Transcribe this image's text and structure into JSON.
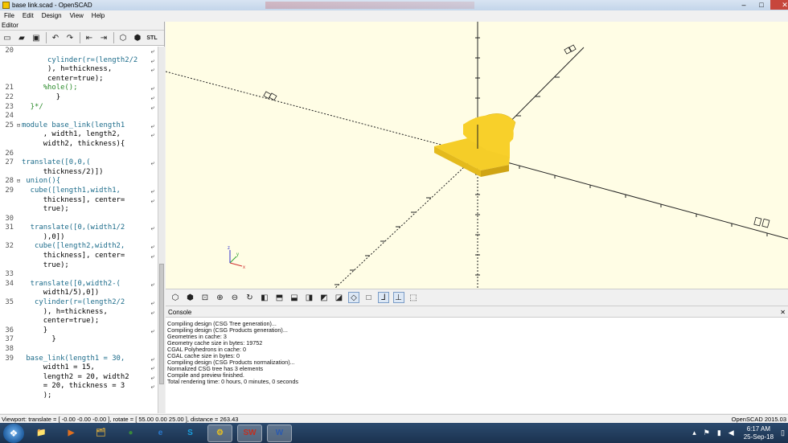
{
  "window": {
    "title": "base link.scad - OpenSCAD",
    "controls": {
      "minimize": "–",
      "maximize": "□",
      "close": "✕"
    }
  },
  "menu": [
    "File",
    "Edit",
    "Design",
    "View",
    "Help"
  ],
  "editor": {
    "label": "Editor",
    "toolbar": [
      "new-file-icon",
      "open-file-icon",
      "save-file-icon",
      "undo-icon",
      "redo-icon",
      "unindent-icon",
      "indent-icon",
      "preview-icon",
      "render-icon",
      "export-stl-icon"
    ],
    "lines": [
      {
        "n": "20",
        "t": "",
        "wrap": true
      },
      {
        "n": "",
        "t": "      cylinder(r=(length2/2",
        "wrap": true
      },
      {
        "n": "",
        "t": "      ), h=thickness,",
        "wrap": true
      },
      {
        "n": "",
        "t": "      center=true);",
        "wrap": false
      },
      {
        "n": "21",
        "t": "     %hole();",
        "wrap": true
      },
      {
        "n": "22",
        "t": "        }",
        "wrap": true
      },
      {
        "n": "23",
        "t": "  }*/",
        "wrap": true
      },
      {
        "n": "24",
        "t": "",
        "wrap": false
      },
      {
        "n": "25",
        "t": "module base_link(length1",
        "wrap": true,
        "fold": true
      },
      {
        "n": "",
        "t": "     , width1, length2,",
        "wrap": true
      },
      {
        "n": "",
        "t": "     width2, thickness){",
        "wrap": false
      },
      {
        "n": "26",
        "t": "",
        "wrap": false
      },
      {
        "n": "27",
        "t": "translate([0,0,(",
        "wrap": true
      },
      {
        "n": "",
        "t": "     thickness/2)])",
        "wrap": false
      },
      {
        "n": "28",
        "t": " union(){",
        "wrap": false,
        "fold": true
      },
      {
        "n": "29",
        "t": "  cube([length1,width1,",
        "wrap": true
      },
      {
        "n": "",
        "t": "     thickness], center=",
        "wrap": true
      },
      {
        "n": "",
        "t": "     true);",
        "wrap": false
      },
      {
        "n": "30",
        "t": "",
        "wrap": false
      },
      {
        "n": "31",
        "t": "  translate([0,(width1/2",
        "wrap": true
      },
      {
        "n": "",
        "t": "     ),0])",
        "wrap": false
      },
      {
        "n": "32",
        "t": "   cube([length2,width2,",
        "wrap": true
      },
      {
        "n": "",
        "t": "     thickness], center=",
        "wrap": true
      },
      {
        "n": "",
        "t": "     true);",
        "wrap": false
      },
      {
        "n": "33",
        "t": "",
        "wrap": false
      },
      {
        "n": "34",
        "t": "  translate([0,width2-(",
        "wrap": true
      },
      {
        "n": "",
        "t": "     width1/5),0])",
        "wrap": false
      },
      {
        "n": "35",
        "t": "   cylinder(r=(length2/2",
        "wrap": true
      },
      {
        "n": "",
        "t": "     ), h=thickness,",
        "wrap": true
      },
      {
        "n": "",
        "t": "     center=true);",
        "wrap": false
      },
      {
        "n": "36",
        "t": "     }",
        "wrap": true
      },
      {
        "n": "37",
        "t": "       }",
        "wrap": false
      },
      {
        "n": "38",
        "t": "",
        "wrap": false
      },
      {
        "n": "39",
        "t": " base_link(length1 = 30,",
        "wrap": true
      },
      {
        "n": "",
        "t": "     width1 = 15,",
        "wrap": true
      },
      {
        "n": "",
        "t": "     length2 = 20, width2",
        "wrap": true
      },
      {
        "n": "",
        "t": "     = 20, thickness = 3",
        "wrap": true
      },
      {
        "n": "",
        "t": "     );",
        "wrap": false
      }
    ]
  },
  "viewtoolbar": [
    "preview-icon",
    "render-icon",
    "view-all-icon",
    "zoom-in-icon",
    "zoom-out-icon",
    "reset-view-icon",
    "view-right-icon",
    "view-top-icon",
    "view-bottom-icon",
    "view-left-icon",
    "view-front-icon",
    "view-back-icon",
    "perspective-icon",
    "orthogonal-icon",
    "show-axes-icon",
    "show-scale-icon",
    "show-edges-icon"
  ],
  "console": {
    "label": "Console",
    "close": "✕",
    "lines": [
      "Compiling design (CSG Tree generation)...",
      "Compiling design (CSG Products generation)...",
      "Geometries in cache: 3",
      "Geometry cache size in bytes: 19752",
      "CGAL Polyhedrons in cache: 0",
      "CGAL cache size in bytes: 0",
      "Compiling design (CSG Products normalization)...",
      "Normalized CSG tree has 3 elements",
      "Compile and preview finished.",
      "Total rendering time: 0 hours, 0 minutes, 0 seconds"
    ]
  },
  "status": {
    "left": "Viewport: translate = [ -0.00 -0.00 -0.00 ], rotate = [ 55.00 0.00 25.00 ], distance = 263.43",
    "right": "OpenSCAD 2015.03"
  },
  "viewport": {
    "axis_labels": {
      "x": "x",
      "y": "y",
      "z": "z"
    }
  },
  "taskbar": {
    "apps": [
      {
        "name": "explorer",
        "label": "📁"
      },
      {
        "name": "media-player",
        "label": "▶"
      },
      {
        "name": "file-manager",
        "label": "🗂"
      },
      {
        "name": "chrome",
        "label": "●"
      },
      {
        "name": "internet-explorer",
        "label": "e"
      },
      {
        "name": "skype",
        "label": "S"
      },
      {
        "name": "openscad",
        "label": "⚙"
      },
      {
        "name": "solidworks",
        "label": "SW"
      },
      {
        "name": "word",
        "label": "W"
      }
    ],
    "time": "6:17 AM",
    "date": "25-Sep-18"
  },
  "colors": {
    "object": "#f8d02a",
    "object_side": "#e0b41a",
    "viewport_bg": "#fffde5"
  }
}
